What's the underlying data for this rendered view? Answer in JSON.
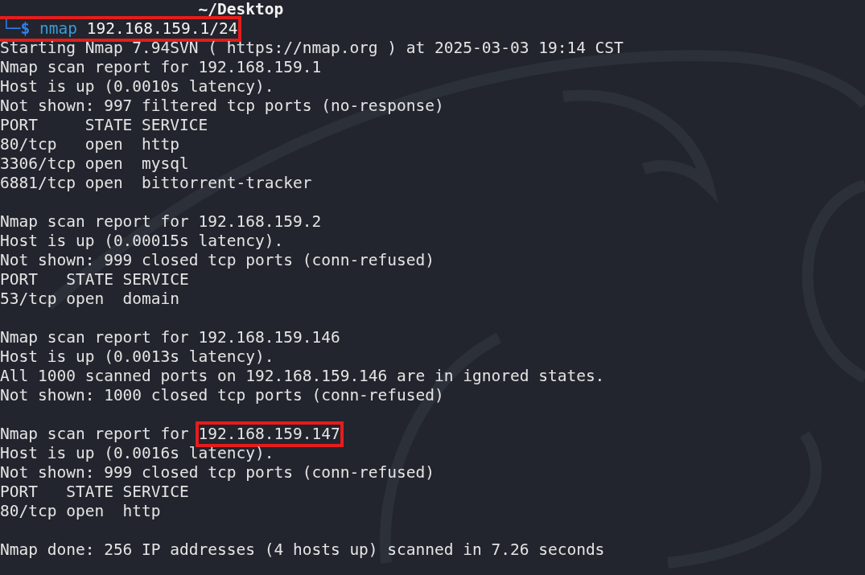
{
  "terminal": {
    "lines": [
      {
        "kind": "header",
        "segments": [
          {
            "kind": "path",
            "text": "~/Desktop",
            "highlighted": false
          }
        ]
      },
      {
        "kind": "prompt",
        "segments": [
          {
            "kind": "prompt",
            "text": "└─$",
            "highlighted": true
          },
          {
            "kind": "command",
            "text": "nmap",
            "highlighted": true
          },
          {
            "kind": "argument",
            "text": "192.168.159.1/24",
            "highlighted": true
          }
        ]
      },
      {
        "kind": "output",
        "segments": [
          {
            "kind": "plain",
            "text": "Starting Nmap 7.94SVN ( https://nmap.org ) at 2025-03-03 19:14 CST",
            "highlighted": false
          }
        ]
      },
      {
        "kind": "output",
        "segments": [
          {
            "kind": "plain",
            "text": "Nmap scan report for 192.168.159.1",
            "highlighted": false
          }
        ]
      },
      {
        "kind": "output",
        "segments": [
          {
            "kind": "plain",
            "text": "Host is up (0.0010s latency).",
            "highlighted": false
          }
        ]
      },
      {
        "kind": "output",
        "segments": [
          {
            "kind": "plain",
            "text": "Not shown: 997 filtered tcp ports (no-response)",
            "highlighted": false
          }
        ]
      },
      {
        "kind": "output",
        "segments": [
          {
            "kind": "plain",
            "text": "PORT     STATE SERVICE",
            "highlighted": false
          }
        ]
      },
      {
        "kind": "output",
        "segments": [
          {
            "kind": "plain",
            "text": "80/tcp   open  http",
            "highlighted": false
          }
        ]
      },
      {
        "kind": "output",
        "segments": [
          {
            "kind": "plain",
            "text": "3306/tcp open  mysql",
            "highlighted": false
          }
        ]
      },
      {
        "kind": "output",
        "segments": [
          {
            "kind": "plain",
            "text": "6881/tcp open  bittorrent-tracker",
            "highlighted": false
          }
        ]
      },
      {
        "kind": "blank"
      },
      {
        "kind": "output",
        "segments": [
          {
            "kind": "plain",
            "text": "Nmap scan report for 192.168.159.2",
            "highlighted": false
          }
        ]
      },
      {
        "kind": "output",
        "segments": [
          {
            "kind": "plain",
            "text": "Host is up (0.00015s latency).",
            "highlighted": false
          }
        ]
      },
      {
        "kind": "output",
        "segments": [
          {
            "kind": "plain",
            "text": "Not shown: 999 closed tcp ports (conn-refused)",
            "highlighted": false
          }
        ]
      },
      {
        "kind": "output",
        "segments": [
          {
            "kind": "plain",
            "text": "PORT   STATE SERVICE",
            "highlighted": false
          }
        ]
      },
      {
        "kind": "output",
        "segments": [
          {
            "kind": "plain",
            "text": "53/tcp open  domain",
            "highlighted": false
          }
        ]
      },
      {
        "kind": "blank"
      },
      {
        "kind": "output",
        "segments": [
          {
            "kind": "plain",
            "text": "Nmap scan report for 192.168.159.146",
            "highlighted": false
          }
        ]
      },
      {
        "kind": "output",
        "segments": [
          {
            "kind": "plain",
            "text": "Host is up (0.0013s latency).",
            "highlighted": false
          }
        ]
      },
      {
        "kind": "output",
        "segments": [
          {
            "kind": "plain",
            "text": "All 1000 scanned ports on 192.168.159.146 are in ignored states.",
            "highlighted": false
          }
        ]
      },
      {
        "kind": "output",
        "segments": [
          {
            "kind": "plain",
            "text": "Not shown: 1000 closed tcp ports (conn-refused)",
            "highlighted": false
          }
        ]
      },
      {
        "kind": "blank"
      },
      {
        "kind": "output",
        "segments": [
          {
            "kind": "plain",
            "text": "Nmap scan report for ",
            "highlighted": false
          },
          {
            "kind": "plain",
            "text": "192.168.159.147",
            "highlighted": true
          }
        ]
      },
      {
        "kind": "output",
        "segments": [
          {
            "kind": "plain",
            "text": "Host is up (0.0016s latency).",
            "highlighted": false
          }
        ]
      },
      {
        "kind": "output",
        "segments": [
          {
            "kind": "plain",
            "text": "Not shown: 999 closed tcp ports (conn-refused)",
            "highlighted": false
          }
        ]
      },
      {
        "kind": "output",
        "segments": [
          {
            "kind": "plain",
            "text": "PORT   STATE SERVICE",
            "highlighted": false
          }
        ]
      },
      {
        "kind": "output",
        "segments": [
          {
            "kind": "plain",
            "text": "80/tcp open  http",
            "highlighted": false
          }
        ]
      },
      {
        "kind": "blank"
      },
      {
        "kind": "output",
        "segments": [
          {
            "kind": "plain",
            "text": "Nmap done: 256 IP addresses (4 hosts up) scanned in 7.26 seconds",
            "highlighted": false
          }
        ]
      }
    ]
  }
}
